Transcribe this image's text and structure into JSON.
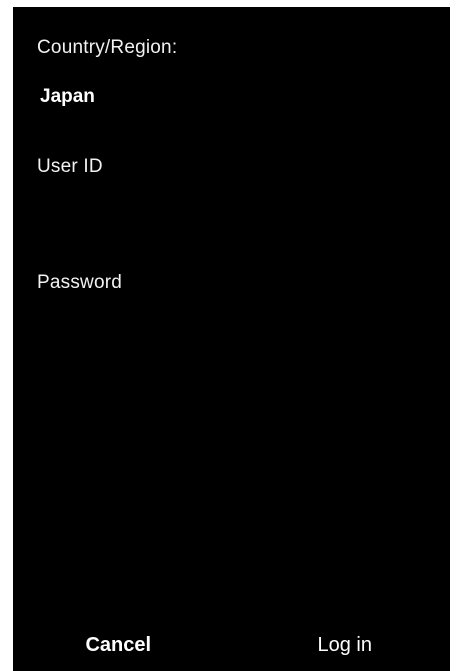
{
  "login_form": {
    "country_label": "Country/Region:",
    "country_value": "Japan",
    "user_id_label": "User ID",
    "user_id_value": "",
    "password_label": "Password",
    "password_value": ""
  },
  "buttons": {
    "cancel_label": "Cancel",
    "login_label": "Log in"
  },
  "colors": {
    "background": "#000000",
    "text": "#ffffff"
  }
}
